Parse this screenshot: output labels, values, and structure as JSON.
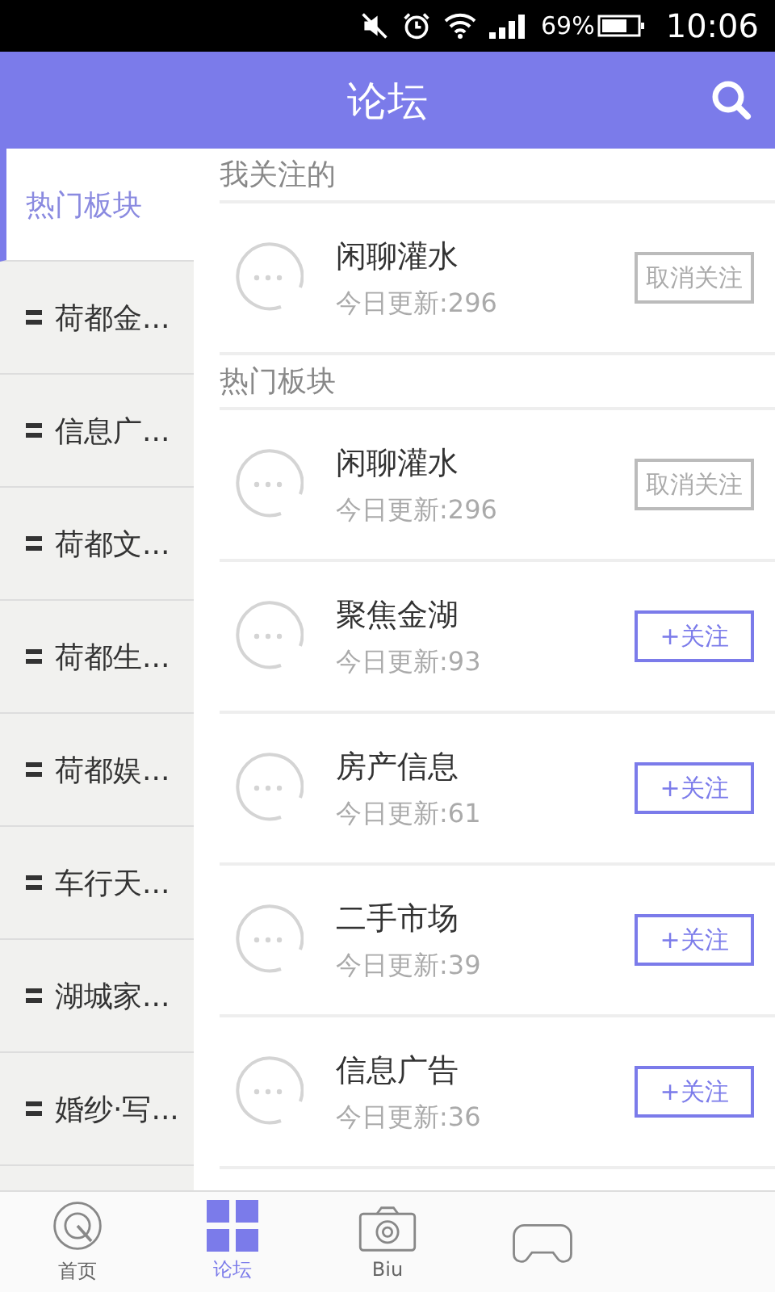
{
  "status_bar": {
    "battery": "69%",
    "time": "10:06"
  },
  "header": {
    "title": "论坛"
  },
  "sidebar": {
    "items": [
      {
        "label": "热门板块",
        "selected": true
      },
      {
        "label": "荷都金...",
        "selected": false
      },
      {
        "label": "信息广...",
        "selected": false
      },
      {
        "label": "荷都文...",
        "selected": false
      },
      {
        "label": "荷都生...",
        "selected": false
      },
      {
        "label": "荷都娱...",
        "selected": false
      },
      {
        "label": "车行天...",
        "selected": false
      },
      {
        "label": "湖城家...",
        "selected": false
      },
      {
        "label": "婚纱·写...",
        "selected": false
      }
    ]
  },
  "sections": [
    {
      "title": "我关注的",
      "boards": [
        {
          "name": "闲聊灌水",
          "updates": "今日更新:296",
          "button": "取消关注",
          "followed": true
        }
      ]
    },
    {
      "title": "热门板块",
      "boards": [
        {
          "name": "闲聊灌水",
          "updates": "今日更新:296",
          "button": "取消关注",
          "followed": true
        },
        {
          "name": "聚焦金湖",
          "updates": "今日更新:93",
          "button": "+关注",
          "followed": false
        },
        {
          "name": "房产信息",
          "updates": "今日更新:61",
          "button": "+关注",
          "followed": false
        },
        {
          "name": "二手市场",
          "updates": "今日更新:39",
          "button": "+关注",
          "followed": false
        },
        {
          "name": "信息广告",
          "updates": "今日更新:36",
          "button": "+关注",
          "followed": false
        }
      ]
    }
  ],
  "tab_bar": {
    "tabs": [
      {
        "kind": "home",
        "label": "首页",
        "selected": false
      },
      {
        "kind": "grid",
        "label": "论坛",
        "selected": true
      },
      {
        "kind": "camera",
        "label": "Biu",
        "selected": false
      },
      {
        "kind": "gamepad",
        "selected": false
      }
    ]
  }
}
